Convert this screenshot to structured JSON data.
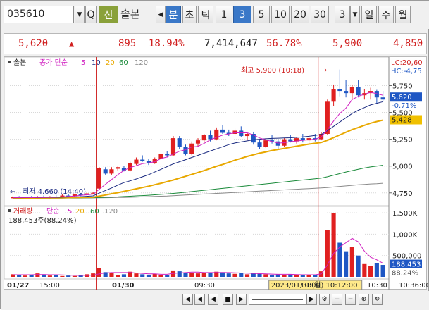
{
  "toolbar": {
    "code": "035610",
    "btn_search_icon": "Q",
    "btn_new": "신",
    "name": "솔본",
    "periods": [
      "분",
      "초",
      "틱",
      "1",
      "3",
      "5",
      "10",
      "20",
      "30"
    ],
    "interval": "3",
    "periods2": [
      "일",
      "주",
      "월"
    ]
  },
  "pricebar": {
    "price": "5,620",
    "change": "895",
    "change_pct": "18.94%",
    "volume": "7,414,647",
    "vol_pct": "56.78%",
    "high": "5,900",
    "low": "4,850"
  },
  "legend": {
    "main": "솔본",
    "ma_title": "종가 단순",
    "ma": [
      "5",
      "10",
      "20",
      "60",
      "120"
    ],
    "vol_title": "거래량",
    "vol_ma_title": "단순",
    "vol_ma": [
      "5",
      "20",
      "60",
      "120"
    ],
    "vol_value": "188,453주(88,24%)"
  },
  "annotations": {
    "high_label": "최고 5,900 (10:18)",
    "low_label": "최저 4,660 (14:40)",
    "lc": "LC:20,60",
    "hc": "HC:-4,75",
    "cur_price": "5,620",
    "cur_pct": "-0.71%",
    "ref_price": "5,428",
    "vol_cur": "188,453",
    "vol_pct": "88.24%",
    "crosshair_time": "2023/01/30(월) 10:12:00"
  },
  "x_axis": {
    "labels": [
      "01/27",
      "15:00",
      "01/30",
      "09:30",
      "10:00",
      "10:30",
      "10:36:00"
    ]
  },
  "colors": {
    "up": "#e02020",
    "down": "#1f57c4",
    "ma5": "#d020c0",
    "ma10": "#1a2a80",
    "ma20": "#e8a800",
    "ma60": "#1a8a3a",
    "ma120": "#8a8a8a"
  },
  "chart_data": {
    "type": "candlestick",
    "price_axis": [
      5750,
      5500,
      5250,
      5000,
      4750
    ],
    "volume_axis": [
      "1,500K",
      "1,000K",
      "500,000"
    ],
    "y_range": [
      4650,
      5950
    ],
    "volume_range": [
      0,
      1600000
    ],
    "candles": [
      {
        "o": 4700,
        "h": 4720,
        "l": 4690,
        "c": 4710,
        "v": 60000
      },
      {
        "o": 4705,
        "h": 4720,
        "l": 4695,
        "c": 4700,
        "v": 40000
      },
      {
        "o": 4700,
        "h": 4715,
        "l": 4690,
        "c": 4710,
        "v": 30000
      },
      {
        "o": 4710,
        "h": 4720,
        "l": 4695,
        "c": 4700,
        "v": 50000
      },
      {
        "o": 4700,
        "h": 4720,
        "l": 4690,
        "c": 4712,
        "v": 80000
      },
      {
        "o": 4712,
        "h": 4725,
        "l": 4700,
        "c": 4705,
        "v": 60000
      },
      {
        "o": 4705,
        "h": 4720,
        "l": 4695,
        "c": 4715,
        "v": 30000
      },
      {
        "o": 4715,
        "h": 4730,
        "l": 4700,
        "c": 4710,
        "v": 40000
      },
      {
        "o": 4710,
        "h": 4735,
        "l": 4700,
        "c": 4725,
        "v": 20000
      },
      {
        "o": 4725,
        "h": 4740,
        "l": 4710,
        "c": 4720,
        "v": 30000
      },
      {
        "o": 4720,
        "h": 4740,
        "l": 4715,
        "c": 4735,
        "v": 20000
      },
      {
        "o": 4735,
        "h": 4745,
        "l": 4720,
        "c": 4730,
        "v": 40000
      },
      {
        "o": 4730,
        "h": 4750,
        "l": 4720,
        "c": 4745,
        "v": 60000
      },
      {
        "o": 4745,
        "h": 4760,
        "l": 4735,
        "c": 4750,
        "v": 80000
      },
      {
        "o": 4790,
        "h": 4990,
        "l": 4790,
        "c": 4980,
        "v": 200000
      },
      {
        "o": 4970,
        "h": 4990,
        "l": 4920,
        "c": 4930,
        "v": 110000
      },
      {
        "o": 4930,
        "h": 4990,
        "l": 4920,
        "c": 4970,
        "v": 90000
      },
      {
        "o": 4975,
        "h": 4995,
        "l": 4960,
        "c": 4990,
        "v": 40000
      },
      {
        "o": 4985,
        "h": 5000,
        "l": 4950,
        "c": 4960,
        "v": 60000
      },
      {
        "o": 4960,
        "h": 5040,
        "l": 4950,
        "c": 5030,
        "v": 120000
      },
      {
        "o": 5020,
        "h": 5080,
        "l": 5010,
        "c": 5060,
        "v": 80000
      },
      {
        "o": 5060,
        "h": 5100,
        "l": 5040,
        "c": 5050,
        "v": 60000
      },
      {
        "o": 5050,
        "h": 5070,
        "l": 5010,
        "c": 5030,
        "v": 50000
      },
      {
        "o": 5030,
        "h": 5080,
        "l": 5020,
        "c": 5070,
        "v": 70000
      },
      {
        "o": 5070,
        "h": 5120,
        "l": 5060,
        "c": 5110,
        "v": 50000
      },
      {
        "o": 5110,
        "h": 5140,
        "l": 5080,
        "c": 5100,
        "v": 40000
      },
      {
        "o": 5100,
        "h": 5280,
        "l": 5090,
        "c": 5260,
        "v": 150000
      },
      {
        "o": 5260,
        "h": 5280,
        "l": 5160,
        "c": 5180,
        "v": 130000
      },
      {
        "o": 5180,
        "h": 5200,
        "l": 5100,
        "c": 5110,
        "v": 90000
      },
      {
        "o": 5110,
        "h": 5230,
        "l": 5100,
        "c": 5210,
        "v": 100000
      },
      {
        "o": 5210,
        "h": 5260,
        "l": 5180,
        "c": 5240,
        "v": 80000
      },
      {
        "o": 5240,
        "h": 5300,
        "l": 5220,
        "c": 5290,
        "v": 90000
      },
      {
        "o": 5290,
        "h": 5330,
        "l": 5230,
        "c": 5250,
        "v": 100000
      },
      {
        "o": 5250,
        "h": 5360,
        "l": 5240,
        "c": 5340,
        "v": 120000
      },
      {
        "o": 5340,
        "h": 5380,
        "l": 5300,
        "c": 5310,
        "v": 110000
      },
      {
        "o": 5310,
        "h": 5340,
        "l": 5280,
        "c": 5300,
        "v": 80000
      },
      {
        "o": 5300,
        "h": 5350,
        "l": 5280,
        "c": 5330,
        "v": 70000
      },
      {
        "o": 5330,
        "h": 5370,
        "l": 5270,
        "c": 5280,
        "v": 90000
      },
      {
        "o": 5280,
        "h": 5310,
        "l": 5240,
        "c": 5300,
        "v": 60000
      },
      {
        "o": 5300,
        "h": 5320,
        "l": 5200,
        "c": 5220,
        "v": 80000
      },
      {
        "o": 5220,
        "h": 5250,
        "l": 5160,
        "c": 5180,
        "v": 70000
      },
      {
        "o": 5180,
        "h": 5260,
        "l": 5170,
        "c": 5240,
        "v": 60000
      },
      {
        "o": 5240,
        "h": 5290,
        "l": 5210,
        "c": 5230,
        "v": 50000
      },
      {
        "o": 5230,
        "h": 5250,
        "l": 5150,
        "c": 5190,
        "v": 60000
      },
      {
        "o": 5190,
        "h": 5260,
        "l": 5180,
        "c": 5250,
        "v": 50000
      },
      {
        "o": 5250,
        "h": 5290,
        "l": 5220,
        "c": 5230,
        "v": 60000
      },
      {
        "o": 5230,
        "h": 5270,
        "l": 5210,
        "c": 5260,
        "v": 40000
      },
      {
        "o": 5260,
        "h": 5300,
        "l": 5220,
        "c": 5240,
        "v": 50000
      },
      {
        "o": 5240,
        "h": 5280,
        "l": 5210,
        "c": 5260,
        "v": 40000
      },
      {
        "o": 5260,
        "h": 5300,
        "l": 5230,
        "c": 5250,
        "v": 50000
      },
      {
        "o": 5250,
        "h": 5320,
        "l": 5240,
        "c": 5300,
        "v": 130000
      },
      {
        "o": 5300,
        "h": 5620,
        "l": 5290,
        "c": 5600,
        "v": 1100000
      },
      {
        "o": 5600,
        "h": 5760,
        "l": 5560,
        "c": 5720,
        "v": 1500000
      },
      {
        "o": 5720,
        "h": 5900,
        "l": 5650,
        "c": 5700,
        "v": 800000
      },
      {
        "o": 5700,
        "h": 5800,
        "l": 5640,
        "c": 5680,
        "v": 600000
      },
      {
        "o": 5680,
        "h": 5760,
        "l": 5620,
        "c": 5740,
        "v": 700000
      },
      {
        "o": 5740,
        "h": 5800,
        "l": 5640,
        "c": 5660,
        "v": 500000
      },
      {
        "o": 5660,
        "h": 5720,
        "l": 5620,
        "c": 5680,
        "v": 300000
      },
      {
        "o": 5680,
        "h": 5730,
        "l": 5620,
        "c": 5700,
        "v": 250000
      },
      {
        "o": 5700,
        "h": 5710,
        "l": 5580,
        "c": 5640,
        "v": 320000
      },
      {
        "o": 5640,
        "h": 5700,
        "l": 5600,
        "c": 5620,
        "v": 280000
      }
    ],
    "ma_lines": {
      "ma5": [
        4705,
        4706,
        4707,
        4706,
        4707,
        4708,
        4709,
        4710,
        4714,
        4716,
        4720,
        4727,
        4732,
        4737,
        4784,
        4830,
        4874,
        4919,
        4960,
        4986,
        5004,
        5022,
        5030,
        5040,
        5070,
        5084,
        5112,
        5138,
        5152,
        5178,
        5184,
        5212,
        5244,
        5268,
        5288,
        5300,
        5310,
        5310,
        5310,
        5290,
        5262,
        5244,
        5230,
        5214,
        5218,
        5228,
        5234,
        5240,
        5246,
        5250,
        5272,
        5340,
        5420,
        5490,
        5540,
        5620,
        5650,
        5670,
        5688,
        5674,
        5660
      ],
      "ma10": [
        4705,
        4705,
        4706,
        4706,
        4706,
        4707,
        4708,
        4708,
        4710,
        4712,
        4713,
        4715,
        4718,
        4722,
        4748,
        4772,
        4796,
        4822,
        4846,
        4862,
        4880,
        4900,
        4920,
        4945,
        4970,
        4995,
        5020,
        5040,
        5060,
        5080,
        5100,
        5120,
        5140,
        5160,
        5180,
        5200,
        5215,
        5225,
        5235,
        5245,
        5250,
        5255,
        5258,
        5260,
        5262,
        5264,
        5268,
        5272,
        5278,
        5285,
        5295,
        5330,
        5370,
        5410,
        5450,
        5490,
        5520,
        5545,
        5570,
        5585,
        5600
      ],
      "ma20": [
        4700,
        4701,
        4702,
        4702,
        4703,
        4703,
        4704,
        4704,
        4705,
        4706,
        4707,
        4708,
        4709,
        4710,
        4720,
        4730,
        4742,
        4752,
        4764,
        4776,
        4788,
        4800,
        4812,
        4826,
        4840,
        4855,
        4870,
        4888,
        4905,
        4922,
        4940,
        4958,
        4978,
        4998,
        5015,
        5035,
        5055,
        5072,
        5090,
        5105,
        5120,
        5132,
        5145,
        5155,
        5165,
        5175,
        5185,
        5195,
        5205,
        5212,
        5220,
        5240,
        5265,
        5290,
        5315,
        5340,
        5360,
        5380,
        5400,
        5415,
        5428
      ],
      "ma60": [
        4700,
        4700,
        4700,
        4701,
        4701,
        4701,
        4702,
        4702,
        4702,
        4703,
        4703,
        4704,
        4704,
        4705,
        4707,
        4709,
        4711,
        4713,
        4716,
        4719,
        4722,
        4725,
        4728,
        4732,
        4736,
        4740,
        4745,
        4750,
        4756,
        4762,
        4768,
        4774,
        4780,
        4786,
        4792,
        4798,
        4804,
        4810,
        4816,
        4822,
        4828,
        4834,
        4840,
        4846,
        4852,
        4858,
        4864,
        4870,
        4876,
        4882,
        4888,
        4900,
        4915,
        4930,
        4945,
        4958,
        4970,
        4982,
        4992,
        5000,
        5008
      ],
      "ma120": [
        4700,
        4700,
        4700,
        4700,
        4700,
        4701,
        4701,
        4701,
        4701,
        4702,
        4702,
        4702,
        4703,
        4703,
        4704,
        4705,
        4706,
        4707,
        4708,
        4709,
        4711,
        4713,
        4715,
        4717,
        4719,
        4721,
        4724,
        4727,
        4730,
        4733,
        4736,
        4739,
        4742,
        4745,
        4748,
        4751,
        4754,
        4757,
        4760,
        4763,
        4766,
        4769,
        4772,
        4775,
        4778,
        4781,
        4784,
        4787,
        4790,
        4793,
        4796,
        4800,
        4805,
        4810,
        4815,
        4820,
        4825,
        4829,
        4833,
        4836,
        4840
      ]
    },
    "vol_ma": [
      50000,
      50000,
      50000,
      50000,
      55000,
      55000,
      50000,
      50000,
      45000,
      40000,
      35000,
      35000,
      35000,
      40000,
      70000,
      90000,
      100000,
      100000,
      100000,
      100000,
      90000,
      80000,
      70000,
      70000,
      60000,
      60000,
      80000,
      90000,
      100000,
      110000,
      110000,
      100000,
      100000,
      100000,
      100000,
      100000,
      95000,
      90000,
      85000,
      80000,
      75000,
      70000,
      65000,
      60000,
      60000,
      60000,
      55000,
      50000,
      50000,
      50000,
      70000,
      280000,
      550000,
      700000,
      800000,
      900000,
      820000,
      600000,
      460000,
      400000,
      320000
    ]
  }
}
